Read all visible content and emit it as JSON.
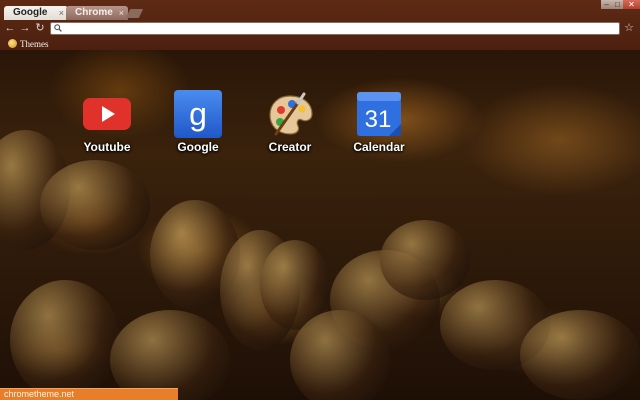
{
  "tabs": [
    {
      "label": "Google",
      "active": true
    },
    {
      "label": "Chrome",
      "active": false
    }
  ],
  "tab_close_glyph": "×",
  "window_controls": {
    "minimize": "–",
    "maximize": "□",
    "close": "✕"
  },
  "toolbar": {
    "back_glyph": "←",
    "forward_glyph": "→",
    "reload_glyph": "↻",
    "star_glyph": "☆",
    "omnibox_value": ""
  },
  "bookmarks": [
    {
      "label": "Themes",
      "icon": "themes-icon"
    }
  ],
  "shortcuts": [
    {
      "label": "Youtube",
      "icon": "youtube-icon",
      "color": "#e0312b"
    },
    {
      "label": "Google",
      "icon": "google-icon",
      "color": "#2f6fe0"
    },
    {
      "label": "Creator",
      "icon": "palette-icon",
      "color": "#d9a86a"
    },
    {
      "label": "Calendar",
      "icon": "calendar-icon",
      "color": "#2f6fe0",
      "day": "31"
    }
  ],
  "status": {
    "text": "chrometheme.net"
  },
  "colors": {
    "frame": "#5e2a14",
    "status_bar": "#e97e2a",
    "youtube_red": "#e0312b",
    "google_blue": "#2f6fe0"
  }
}
